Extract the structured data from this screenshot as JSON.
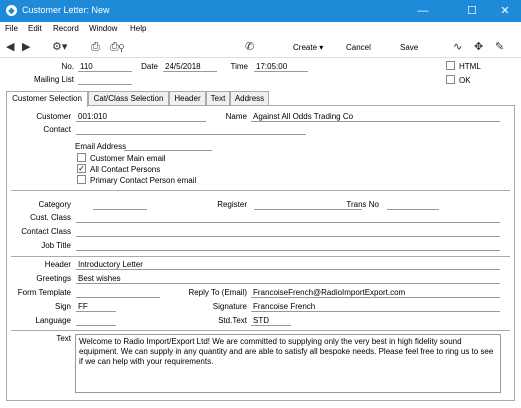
{
  "window": {
    "title": "Customer Letter: New",
    "minimize": "—",
    "maximize": "☐",
    "close": "✕"
  },
  "menu": [
    "File",
    "Edit",
    "Record",
    "Window",
    "Help"
  ],
  "toolbar": {
    "create": "Create",
    "cancel": "Cancel",
    "save": "Save"
  },
  "header_fields": {
    "no_label": "No.",
    "no_value": "110",
    "date_label": "Date",
    "date_value": "24/5/2018",
    "time_label": "Time",
    "time_value": "17:05:00",
    "mailing_list_label": "Mailing List",
    "mailing_list_value": "",
    "html_label": "HTML",
    "ok_label": "OK"
  },
  "tabs": [
    "Customer Selection",
    "Cat/Class Selection",
    "Header",
    "Text",
    "Address"
  ],
  "customer": {
    "customer_label": "Customer",
    "customer_value": "001:010",
    "name_label": "Name",
    "name_value": "Against All Odds Trading Co",
    "contact_label": "Contact",
    "contact_value": "",
    "email_label": "Email Address",
    "options": [
      {
        "label": "Customer Main email",
        "checked": false
      },
      {
        "label": "All Contact Persons",
        "checked": true
      },
      {
        "label": "Primary Contact Person email",
        "checked": false
      }
    ]
  },
  "classification": {
    "category_label": "Category",
    "register_label": "Register",
    "trans_no_label": "Trans No",
    "cust_class_label": "Cust. Class",
    "contact_class_label": "Contact Class",
    "job_title_label": "Job Title"
  },
  "letter": {
    "header_label": "Header",
    "header_value": "Introductory Letter",
    "greetings_label": "Greetings",
    "greetings_value": "Best wishes",
    "form_template_label": "Form Template",
    "form_template_value": "",
    "reply_to_label": "Reply To (Email)",
    "reply_to_value": "FrancoiseFrench@RadioImportExport.com",
    "sign_label": "Sign",
    "sign_value": "FF",
    "signature_label": "Signature",
    "signature_value": "Francoise French",
    "language_label": "Language",
    "language_value": "",
    "std_text_label": "Std.Text",
    "std_text_value": "STD",
    "text_label": "Text",
    "text_value": "Welcome to Radio Import/Export Ltd! We are committed to supplying only the very best in high fidelity sound equipment. We can supply in any quantity and are able to satisfy all bespoke needs. Please feel free to ring us to see if we can help with your requirements."
  }
}
